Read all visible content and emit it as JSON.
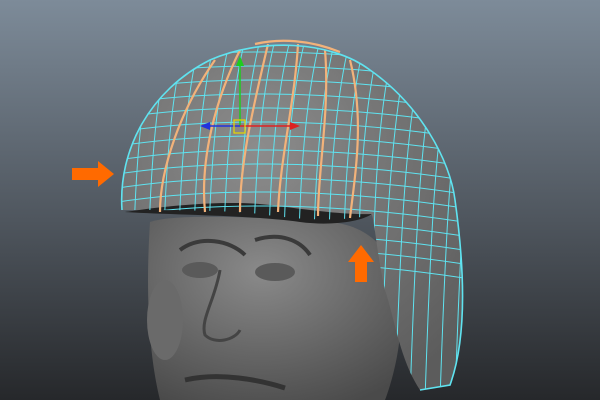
{
  "viewport": {
    "background_top": "#7d8b99",
    "background_bottom": "#26282b",
    "wire_color": "#5fe3f0",
    "edge_loop_color": "#f2b27a",
    "arrow_color": "#ff6a00",
    "mesh_color": "#7a7a7a"
  },
  "icons": [
    "move-manipulator-icon",
    "arrow-right-icon",
    "arrow-up-icon"
  ]
}
